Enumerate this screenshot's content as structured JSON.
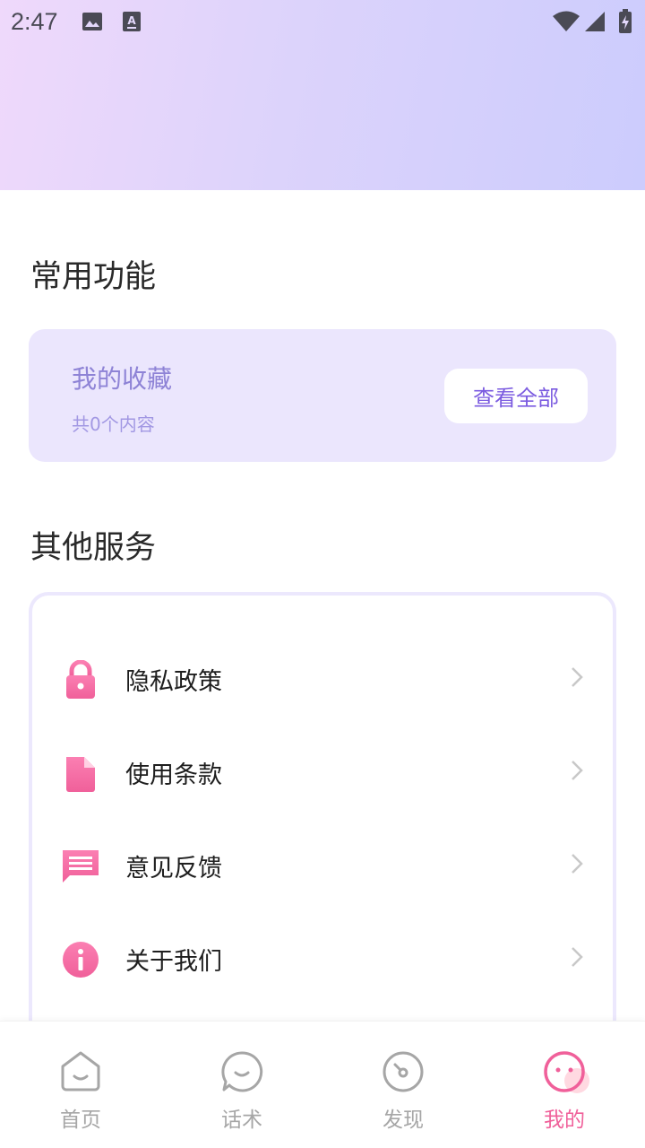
{
  "status_bar": {
    "time": "2:47",
    "icons": [
      "image-icon",
      "font-download-icon",
      "wifi-icon",
      "signal-icon",
      "battery-charging-icon"
    ]
  },
  "sections": {
    "common": {
      "title": "常用功能",
      "favorites": {
        "title": "我的收藏",
        "count_text": "共0个内容",
        "view_all_label": "查看全部"
      }
    },
    "other": {
      "title": "其他服务",
      "items": [
        {
          "label": "隐私政策",
          "icon": "lock-icon"
        },
        {
          "label": "使用条款",
          "icon": "document-icon"
        },
        {
          "label": "意见反馈",
          "icon": "message-icon"
        },
        {
          "label": "关于我们",
          "icon": "info-icon"
        }
      ]
    }
  },
  "tabbar": {
    "tabs": [
      {
        "label": "首页",
        "icon": "home-icon",
        "active": false
      },
      {
        "label": "话术",
        "icon": "chat-bubble-icon",
        "active": false
      },
      {
        "label": "发现",
        "icon": "compass-icon",
        "active": false
      },
      {
        "label": "我的",
        "icon": "profile-face-icon",
        "active": true
      }
    ]
  },
  "colors": {
    "accent_pink": "#f0609a",
    "accent_purple": "#7b5be0",
    "card_bg": "#ebe6fd",
    "header_gradient_start": "#efd9fb",
    "header_gradient_end": "#ccccfd"
  }
}
